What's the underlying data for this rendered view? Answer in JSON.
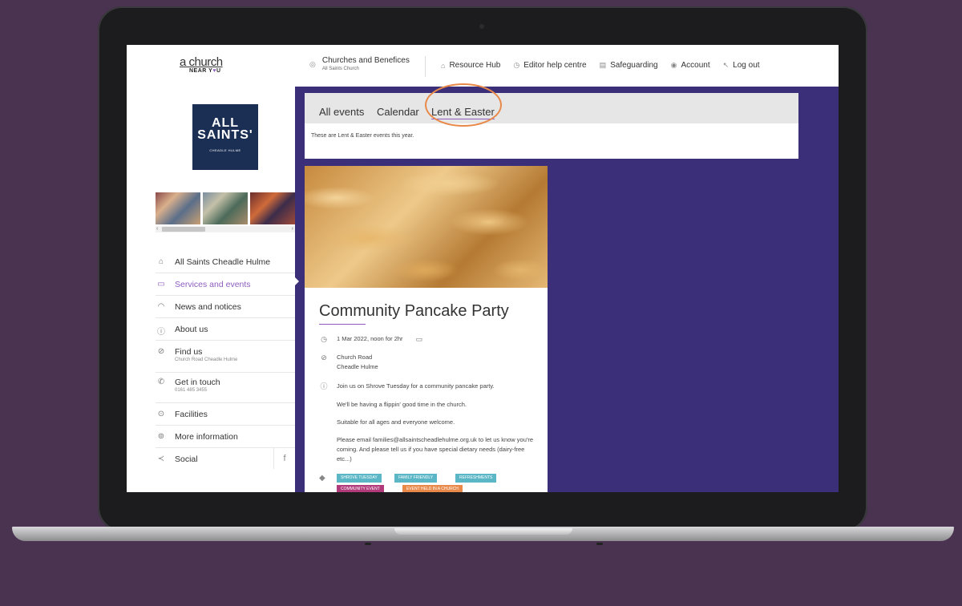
{
  "header": {
    "logo_top": "a church",
    "logo_bottom_a": "NEAR Y",
    "logo_bottom_b": "U",
    "church_title": "Churches and Benefices",
    "church_sub": "All Saints Church",
    "links": [
      {
        "label": "Resource Hub",
        "icon": "building-icon"
      },
      {
        "label": "Editor help centre",
        "icon": "question-icon"
      },
      {
        "label": "Safeguarding",
        "icon": "shield-icon"
      },
      {
        "label": "Account",
        "icon": "user-icon"
      },
      {
        "label": "Log out",
        "icon": "logout-icon"
      }
    ]
  },
  "sidebar": {
    "crest": {
      "line1": "ALL",
      "line2": "SAINTS'",
      "line3": "CHEADLE HULME"
    },
    "items": [
      {
        "label": "All Saints Cheadle Hulme",
        "sub": "",
        "icon": "home-icon"
      },
      {
        "label": "Services and events",
        "sub": "",
        "icon": "calendar-icon"
      },
      {
        "label": "News and notices",
        "sub": "",
        "icon": "news-icon"
      },
      {
        "label": "About us",
        "sub": "",
        "icon": "info-icon"
      },
      {
        "label": "Find us",
        "sub": "Church Road Cheadle Hulme",
        "icon": "location-icon"
      },
      {
        "label": "Get in touch",
        "sub": "0161 485 3455",
        "icon": "phone-icon"
      },
      {
        "label": "Facilities",
        "sub": "",
        "icon": "check-icon"
      },
      {
        "label": "More information",
        "sub": "",
        "icon": "help-icon"
      },
      {
        "label": "Social",
        "sub": "",
        "icon": "share-icon"
      }
    ],
    "social_fb": "f"
  },
  "tabs": {
    "items": [
      "All events",
      "Calendar",
      "Lent & Easter"
    ],
    "active": "Lent & Easter",
    "description": "These are Lent & Easter events this year."
  },
  "event": {
    "title": "Community Pancake Party",
    "datetime": "1 Mar 2022, noon for 2hr",
    "location_line1": "Church Road",
    "location_line2": "Cheadle Hulme",
    "desc1": "Join us on Shrove Tuesday for a community pancake party.",
    "desc2": "We'll be having a flippin' good time in the church.",
    "desc3": "Suitable for all ages and everyone welcome.",
    "desc4": "Please email families@allsaintscheadlehulme.org.uk to let us know you're coming. And please tell us if you have special dietary needs (dairy-free etc...)",
    "tags": [
      {
        "label": "SHROVE TUESDAY",
        "color": "#5bb7c6"
      },
      {
        "label": "FAMILY FRIENDLY",
        "color": "#5bb7c6"
      },
      {
        "label": "REFRESHMENTS",
        "color": "#5bb7c6"
      },
      {
        "label": "COMMUNITY EVENT",
        "color": "#b03a7a"
      },
      {
        "label": "EVENT HELD IN A CHURCH",
        "color": "#e8894a"
      }
    ]
  },
  "colors": {
    "accent": "#8e5dbf",
    "panel_purple": "#3a2f78",
    "background": "#4a3350",
    "highlight_circle": "#e8894a"
  }
}
